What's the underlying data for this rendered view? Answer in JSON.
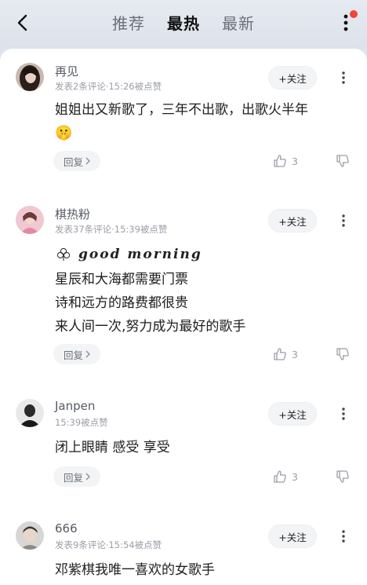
{
  "header": {
    "tabs": [
      "推荐",
      "最热",
      "最新"
    ],
    "active_tab": "最热",
    "notification_dot_color": "#f0453a"
  },
  "comments": [
    {
      "user": "再见",
      "meta": "发表2条评论·15:26被点赞",
      "follow_label": "+关注",
      "lines": [
        "姐姐出又新歌了，三年不出歌，出歌火半年"
      ],
      "emoji": "🤫",
      "reply_label": "回复",
      "likes": "3"
    },
    {
      "user": "棋热粉",
      "meta": "发表37条评论·15:39被点赞",
      "follow_label": "+关注",
      "decor_text": "good morning",
      "lines": [
        "星辰和大海都需要门票",
        "诗和远方的路费都很贵",
        "来人间一次,努力成为最好的歌手"
      ],
      "reply_label": "回复",
      "likes": "3"
    },
    {
      "user": "Janpen",
      "meta": "15:39被点赞",
      "follow_label": "+关注",
      "lines": [
        "闭上眼睛 感受 享受"
      ],
      "reply_label": "回复",
      "likes": "3"
    },
    {
      "user": "666",
      "meta": "发表9条评论·15:54被点赞",
      "follow_label": "+关注",
      "lines": [
        "邓紫棋我唯一喜欢的女歌手"
      ]
    }
  ]
}
